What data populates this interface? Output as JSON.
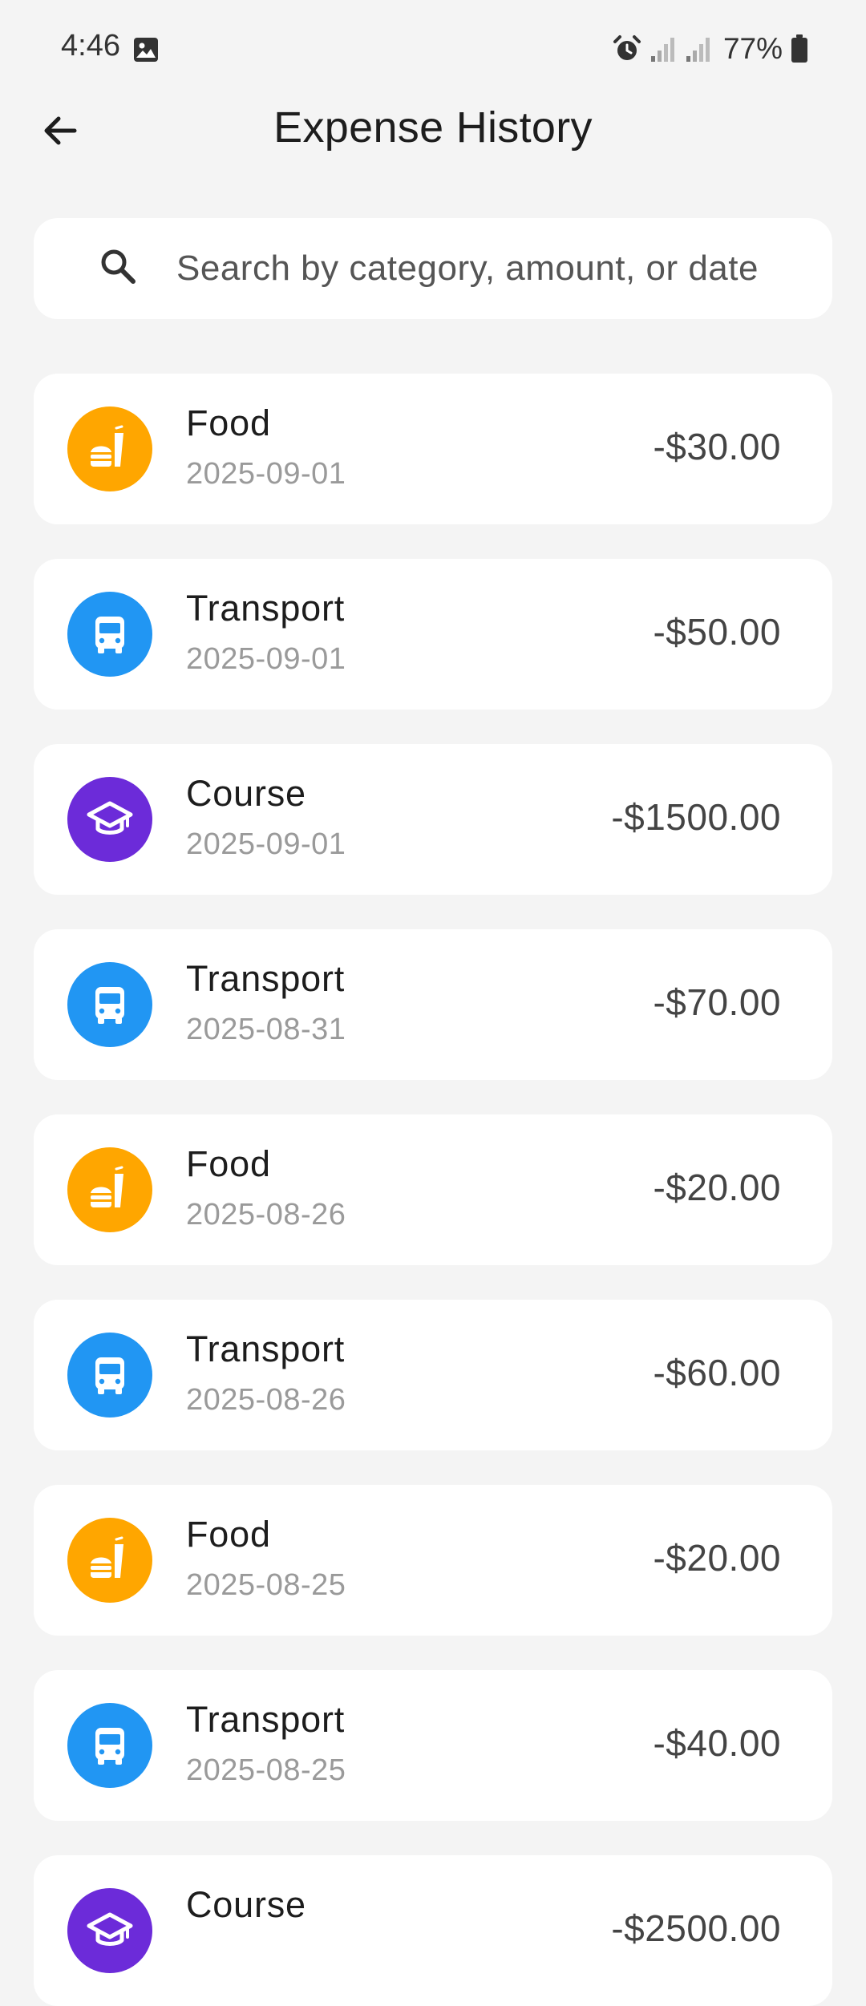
{
  "status_bar": {
    "time": "4:46",
    "battery": "77%",
    "icons": [
      "gallery-icon",
      "alarm-icon",
      "signal-icon",
      "signal-icon",
      "battery-icon"
    ]
  },
  "app_bar": {
    "title": "Expense History",
    "back_icon": "arrow-left-icon"
  },
  "search": {
    "placeholder": "Search by category, amount, or date",
    "value": "",
    "icon": "search-icon"
  },
  "colors": {
    "food": "#FFA600",
    "transport": "#2196F3",
    "course": "#6C2BD9",
    "background": "#F4F4F4",
    "card": "#FFFFFF"
  },
  "expenses": [
    {
      "category": "Food",
      "date": "2025-09-01",
      "amount": "-$30.00",
      "icon": "fastfood-icon"
    },
    {
      "category": "Transport",
      "date": "2025-09-01",
      "amount": "-$50.00",
      "icon": "bus-icon"
    },
    {
      "category": "Course",
      "date": "2025-09-01",
      "amount": "-$1500.00",
      "icon": "graduation-cap-icon"
    },
    {
      "category": "Transport",
      "date": "2025-08-31",
      "amount": "-$70.00",
      "icon": "bus-icon"
    },
    {
      "category": "Food",
      "date": "2025-08-26",
      "amount": "-$20.00",
      "icon": "fastfood-icon"
    },
    {
      "category": "Transport",
      "date": "2025-08-26",
      "amount": "-$60.00",
      "icon": "bus-icon"
    },
    {
      "category": "Food",
      "date": "2025-08-25",
      "amount": "-$20.00",
      "icon": "fastfood-icon"
    },
    {
      "category": "Transport",
      "date": "2025-08-25",
      "amount": "-$40.00",
      "icon": "bus-icon"
    },
    {
      "category": "Course",
      "date": "",
      "amount": "-$2500.00",
      "icon": "graduation-cap-icon"
    }
  ]
}
